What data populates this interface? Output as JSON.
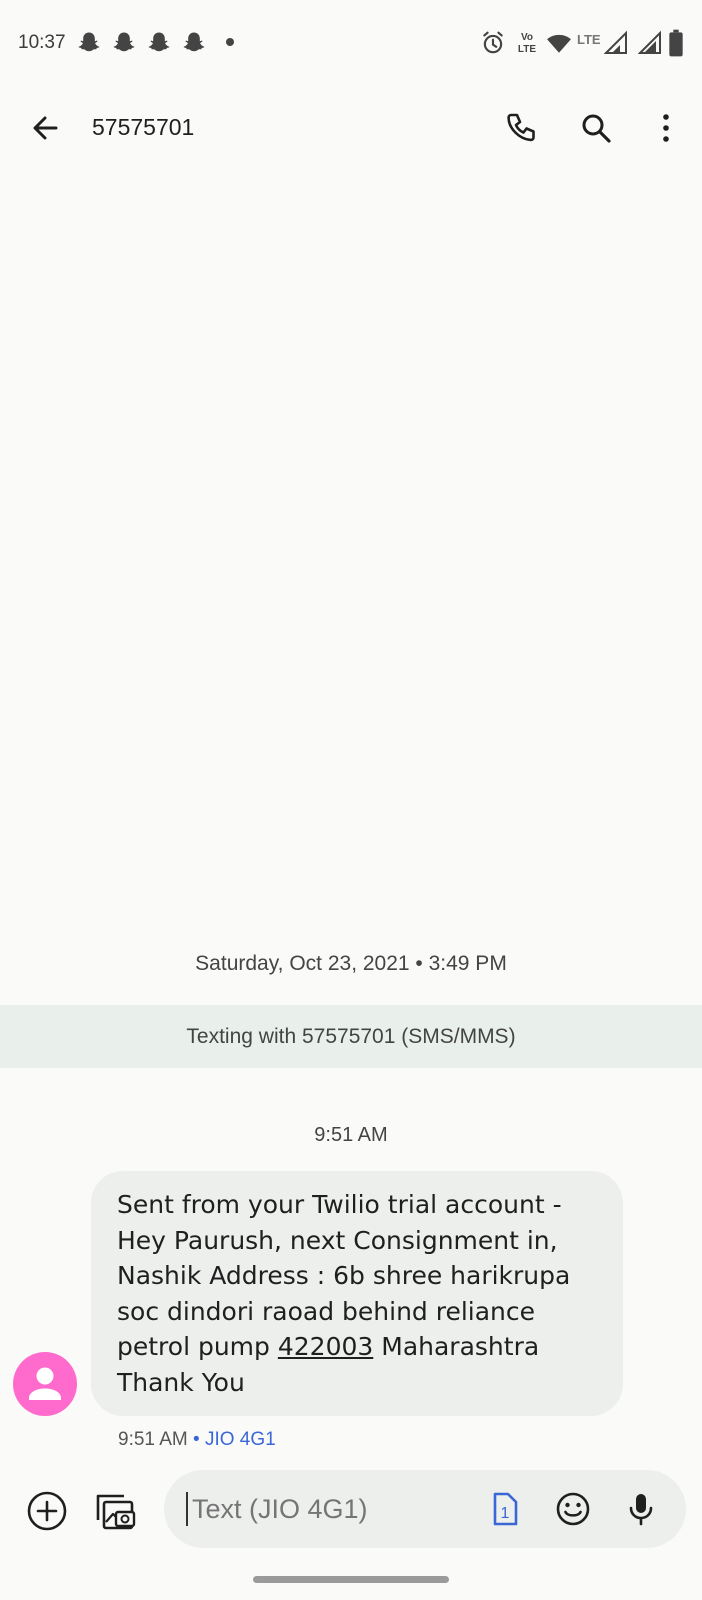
{
  "status_bar": {
    "time": "10:37",
    "icons": [
      "snapchat-icon",
      "snapchat-icon",
      "snapchat-icon",
      "snapchat-icon",
      "dot-icon",
      "alarm-icon",
      "volte-icon",
      "wifi-icon",
      "lte-signal-icon",
      "signal-icon",
      "battery-icon"
    ],
    "volte_label": "Vo LTE",
    "lte_label": "LTE"
  },
  "app_bar": {
    "title": "57575701",
    "back_icon": "back-arrow-icon",
    "call_icon": "phone-icon",
    "search_icon": "search-icon",
    "more_icon": "more-vert-icon"
  },
  "conversation": {
    "date_header": "Saturday, Oct 23, 2021 • 3:49 PM",
    "banner": "Texting with 57575701 (SMS/MMS)",
    "time_header": "9:51 AM",
    "message": {
      "text_before_link": "Sent from your Twilio trial account - Hey Paurush, next Consignment in, Nashik Address : 6b shree harikrupa soc dindori raoad behind reliance petrol pump ",
      "link": "422003",
      "text_after_link": " Maharashtra Thank You",
      "time": "9:51 AM",
      "separator": " • ",
      "sim": "JIO 4G1",
      "avatar_color": "#ff6bcc"
    }
  },
  "compose": {
    "placeholder": "Text (JIO 4G1)",
    "sim_badge": "1",
    "add_icon": "add-circle-icon",
    "gallery_icon": "gallery-icon",
    "emoji_icon": "emoji-icon",
    "mic_icon": "mic-icon",
    "accent_color": "#3b67d6"
  }
}
